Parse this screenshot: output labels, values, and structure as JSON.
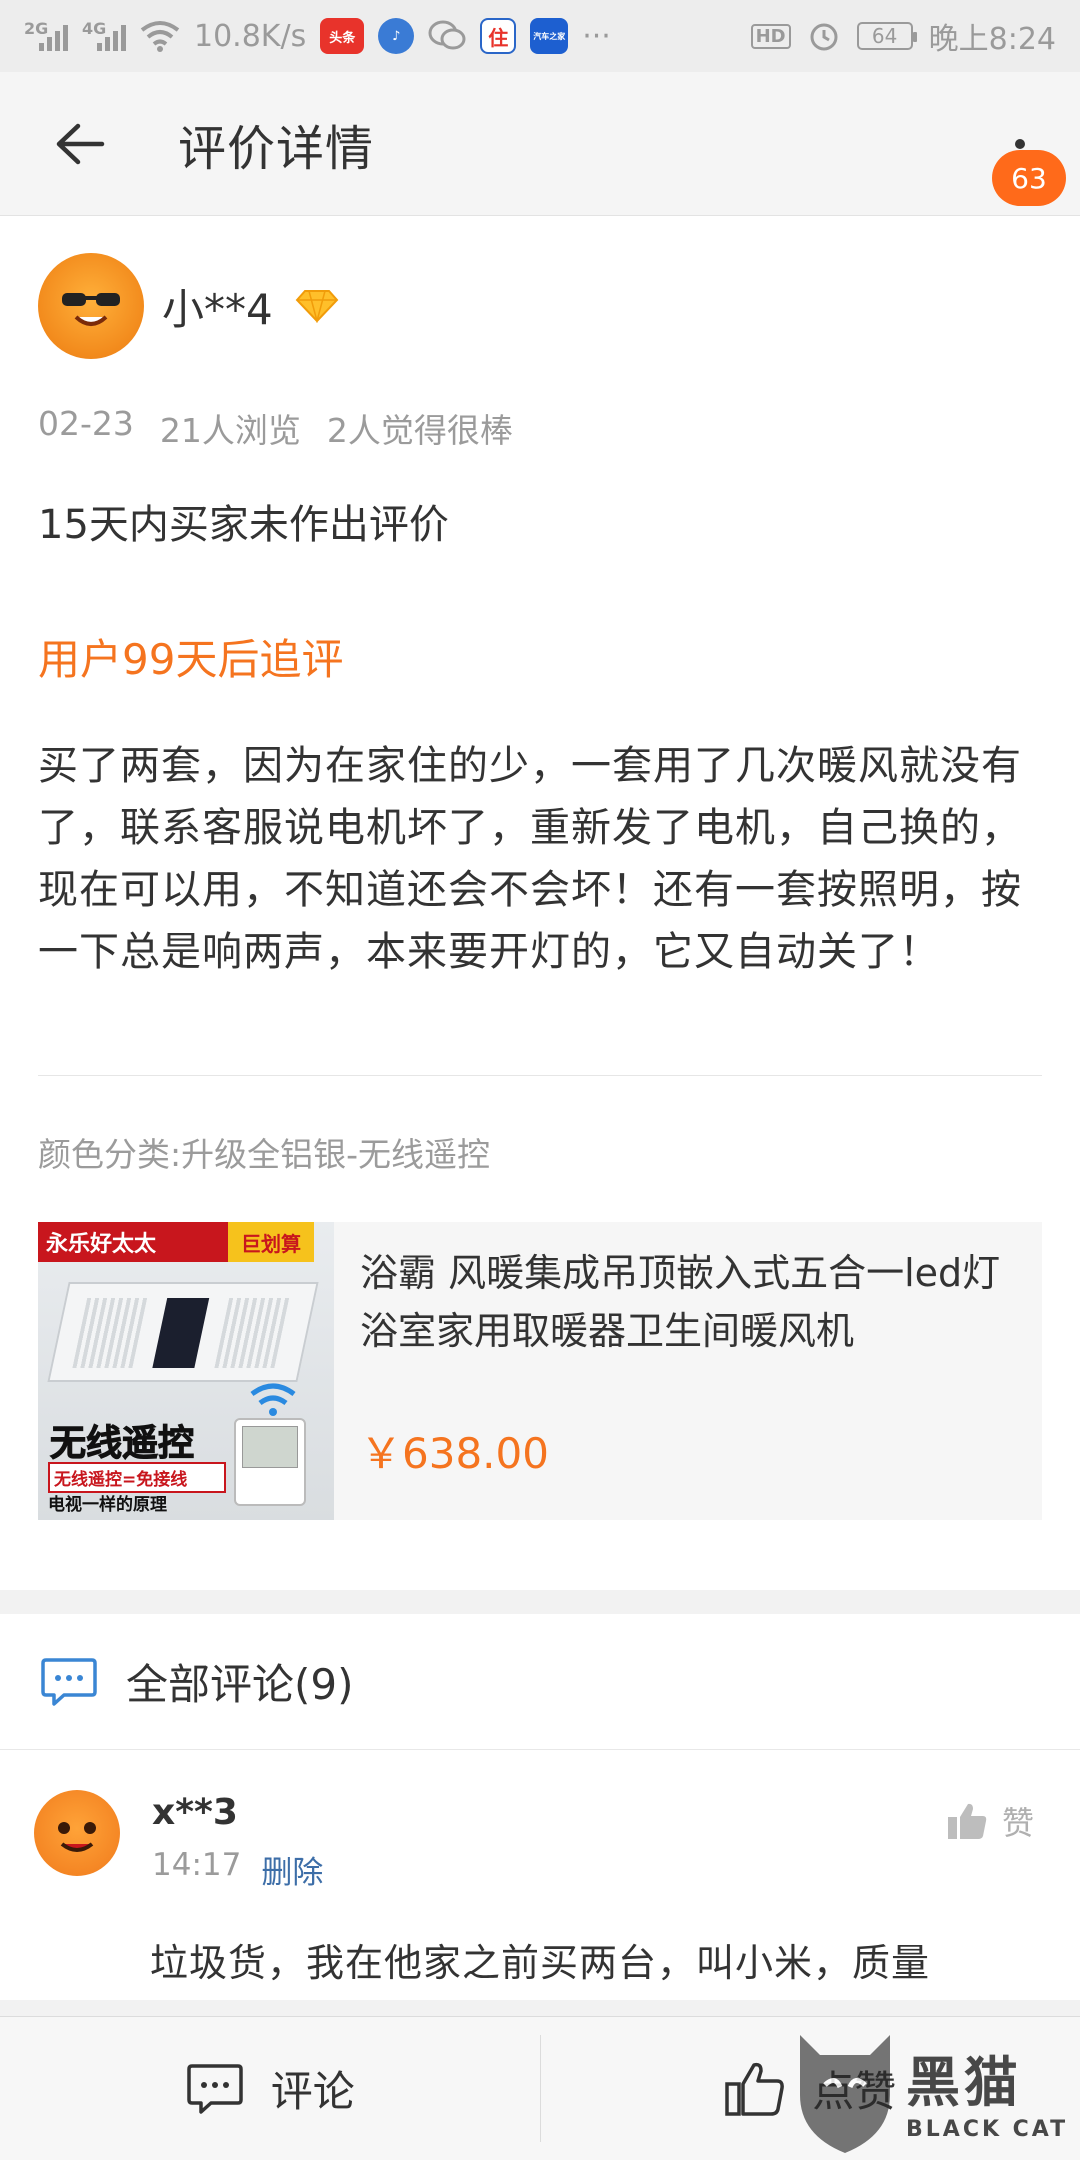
{
  "status_bar": {
    "net_speed": "10.8K/s",
    "signal_1": "2G",
    "signal_2": "4G",
    "hd_badge": "HD",
    "battery": "64",
    "time": "晚上8:24",
    "notif_app_1": "头条",
    "notif_app_3": "住",
    "notif_app_4": "汽车之家",
    "overflow": "···"
  },
  "header": {
    "title": "评价详情",
    "badge_count": "63"
  },
  "review": {
    "user_name": "小**4",
    "date": "02-23",
    "views": "21人浏览",
    "likes": "2人觉得很棒",
    "initial_text": "15天内买家未作出评价",
    "followup_label": "用户99天后追评",
    "followup_text": "买了两套，因为在家住的少，一套用了几次暖风就没有了，联系客服说电机坏了，重新发了电机，自己换的，现在可以用，不知道还会不会坏！还有一套按照明，按一下总是响两声，本来要开灯的，它又自动关了！",
    "sku": "颜色分类:升级全铝银-无线遥控"
  },
  "product": {
    "title": "浴霸 风暖集成吊顶嵌入式五合一led灯浴室家用取暖器卫生间暖风机",
    "price": "￥638.00",
    "img_brand": "永乐好太太",
    "img_tag": "巨划算",
    "img_headline": "无线遥控",
    "img_line1": "无线遥控=免接线",
    "img_line2": "电视一样的原理"
  },
  "comments": {
    "title": "全部评论(9)",
    "items": [
      {
        "name": "x**3",
        "time": "14:17",
        "delete_label": "删除",
        "like_label": "赞",
        "text": "垃圾货，我在他家之前买两台，叫小米，质量"
      }
    ]
  },
  "bottom_bar": {
    "comment_label": "评论",
    "like_label": "点赞"
  },
  "watermark": {
    "text_cn": "黑猫",
    "text_en": "BLACK CAT"
  },
  "colors": {
    "accent_orange": "#f5741f",
    "link_blue": "#3d6ea8",
    "badge_orange": "#ff6a1a"
  }
}
